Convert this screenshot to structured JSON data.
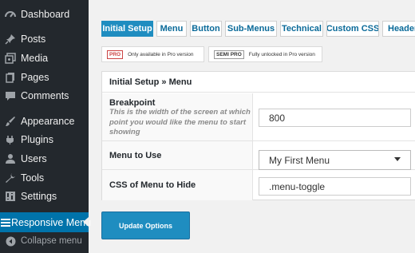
{
  "sidebar": {
    "items": [
      {
        "label": "Dashboard",
        "icon": "dashboard-icon"
      },
      {
        "label": "Posts",
        "icon": "pin-icon"
      },
      {
        "label": "Media",
        "icon": "media-icon"
      },
      {
        "label": "Pages",
        "icon": "pages-icon"
      },
      {
        "label": "Comments",
        "icon": "comments-icon"
      },
      {
        "label": "Appearance",
        "icon": "brush-icon"
      },
      {
        "label": "Plugins",
        "icon": "plug-icon"
      },
      {
        "label": "Users",
        "icon": "user-icon"
      },
      {
        "label": "Tools",
        "icon": "wrench-icon"
      },
      {
        "label": "Settings",
        "icon": "settings-icon"
      },
      {
        "label": "Responsive Menu",
        "icon": "menu-icon",
        "active": true
      }
    ],
    "collapse_label": "Collapse menu"
  },
  "tabs": [
    "Initial Setup",
    "Menu",
    "Button",
    "Sub-Menus",
    "Technical",
    "Custom CSS",
    "Header"
  ],
  "notices": {
    "pro_badge": "PRO",
    "pro_text": "Only available in Pro version",
    "semi_badge": "SEMI PRO",
    "semi_text": "Fully unlocked in Pro version"
  },
  "panel": {
    "title": "Initial Setup » Menu",
    "breakpoint": {
      "label": "Breakpoint",
      "description": "This is the width of the screen at which point you would like the menu to start showing",
      "value": "800"
    },
    "menu_to_use": {
      "label": "Menu to Use",
      "value": "My First Menu"
    },
    "css_to_hide": {
      "label": "CSS of Menu to Hide",
      "value": ".menu-toggle"
    }
  },
  "update_button": "Update Options",
  "colors": {
    "sidebar_bg": "#23282d",
    "accent": "#1f8dc0",
    "active_menu": "#0073aa"
  }
}
